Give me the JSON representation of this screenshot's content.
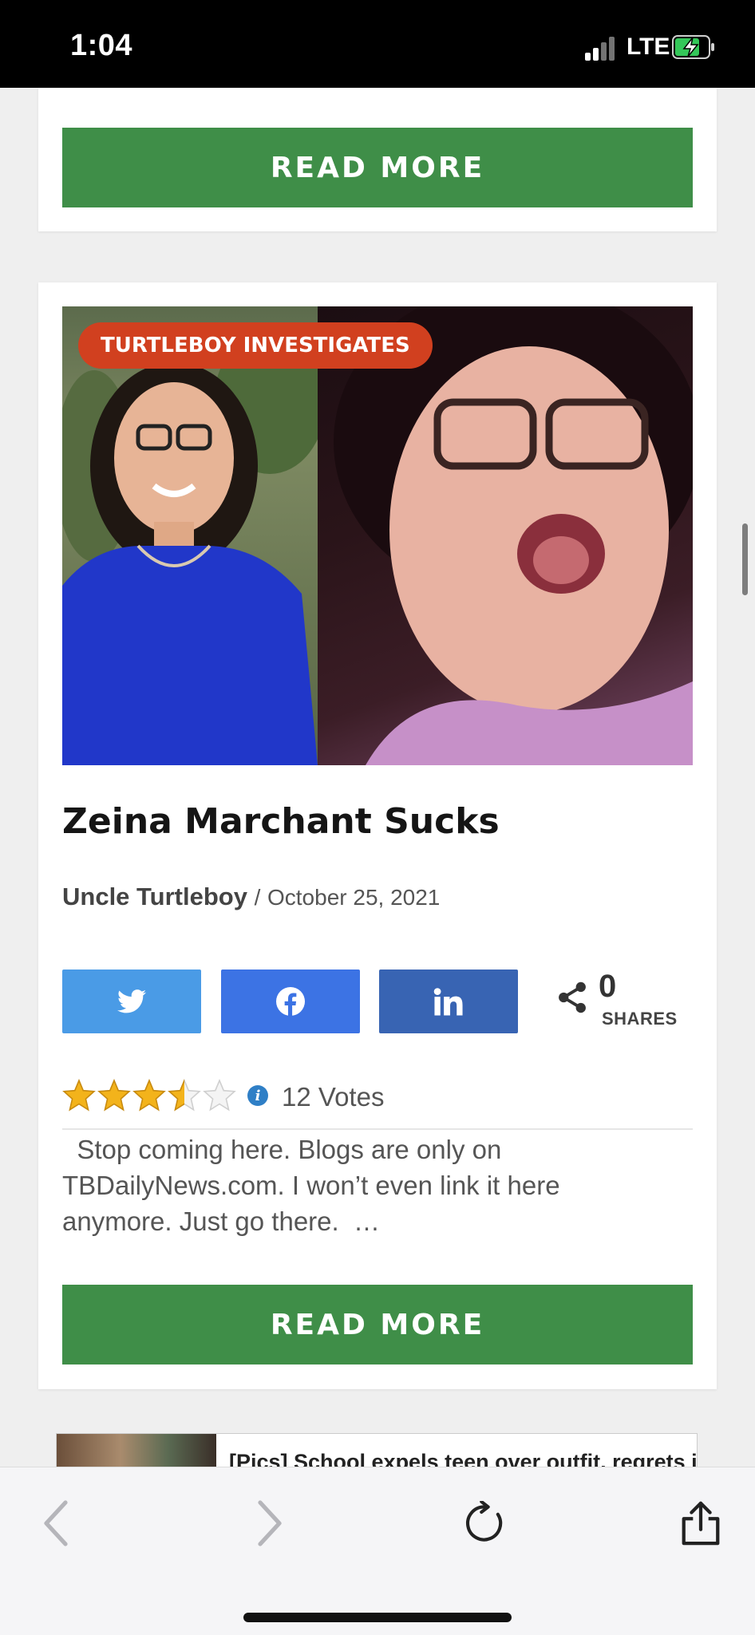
{
  "status_bar": {
    "time": "1:04",
    "network": "LTE"
  },
  "prev_card": {
    "read_more_label": "READ MORE"
  },
  "article": {
    "tag": "TURTLEBOY INVESTIGATES",
    "title": "Zeina Marchant Sucks",
    "author": "Uncle Turtleboy",
    "separator": "/",
    "date": "October 25, 2021",
    "share": {
      "count": "0",
      "count_label": "SHARES",
      "buttons": [
        {
          "network": "twitter",
          "color": "#4a9be6"
        },
        {
          "network": "facebook",
          "color": "#3c73e4"
        },
        {
          "network": "linkedin",
          "color": "#3864b3"
        }
      ]
    },
    "rating": {
      "stars_value": 3.5,
      "stars_max": 5,
      "votes_label": "12 Votes"
    },
    "excerpt": "  Stop coming here. Blogs are only on TBDailyNews.com. I won’t even link it here anymore. Just go there.  …",
    "read_more_label": "READ MORE"
  },
  "ad": {
    "headline": "[Pics] School expels teen over outfit, regrets it"
  },
  "browser_toolbar": {
    "icons": [
      "back-icon",
      "forward-icon",
      "reload-icon",
      "share-icon"
    ]
  },
  "colors": {
    "read_more_green": "#3f8e48",
    "tag_red": "#d1401f",
    "star_gold": "#f3b31b"
  }
}
